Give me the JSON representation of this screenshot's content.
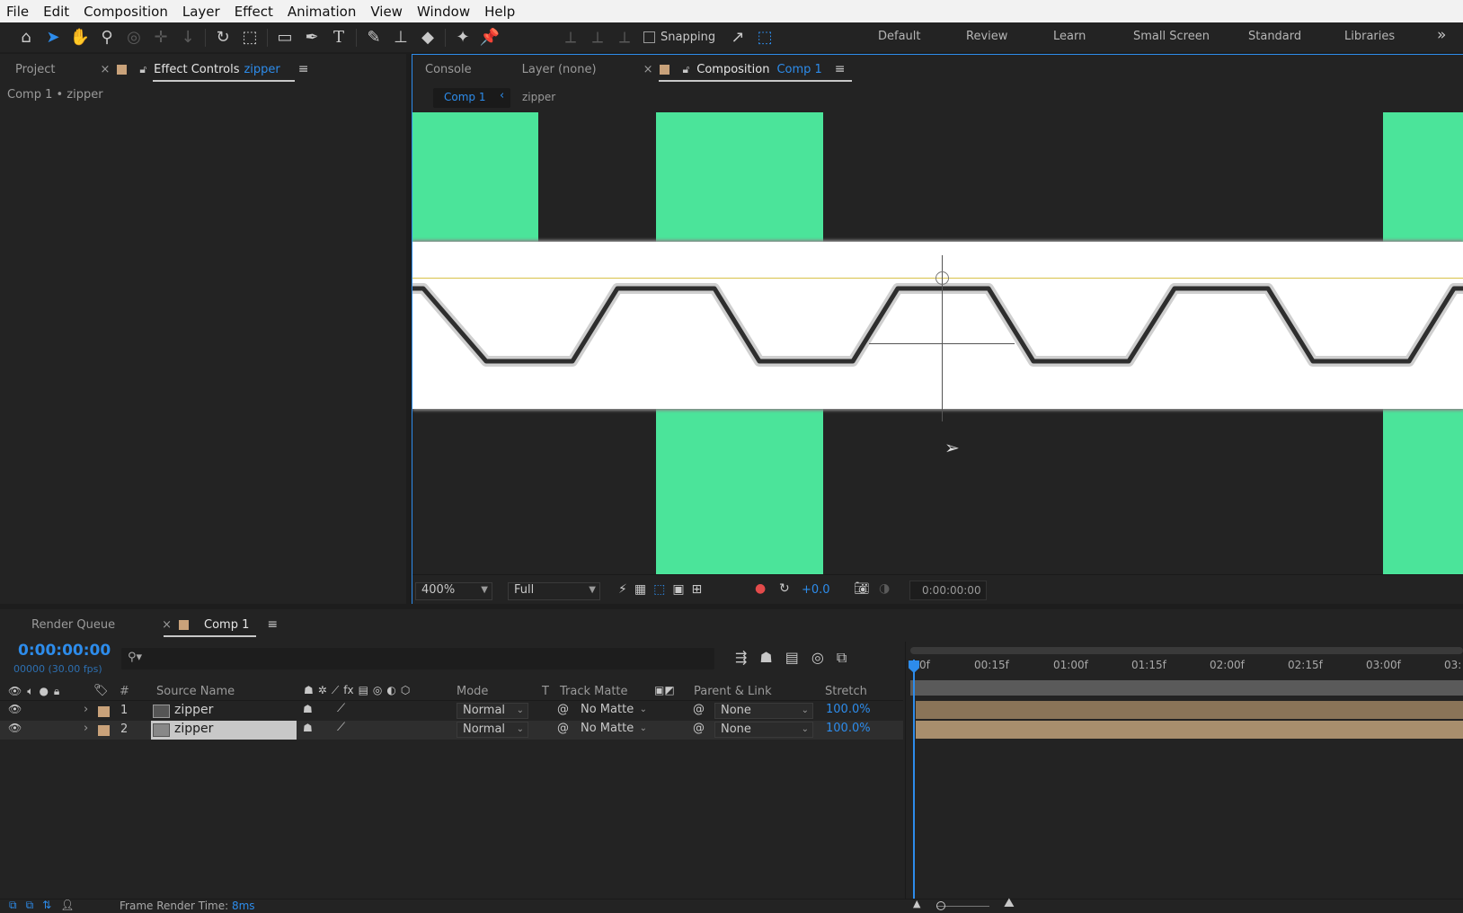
{
  "menu": [
    "File",
    "Edit",
    "Composition",
    "Layer",
    "Effect",
    "Animation",
    "View",
    "Window",
    "Help"
  ],
  "toolbar": {
    "snapping_label": "Snapping",
    "workspaces": [
      "Default",
      "Review",
      "Learn",
      "Small Screen",
      "Standard",
      "Libraries"
    ],
    "more_label": "»"
  },
  "left_panel": {
    "project_tab": "Project",
    "effect_controls_tab": "Effect Controls",
    "effect_controls_target": "zipper",
    "breadcrumb": "Comp 1 • zipper"
  },
  "comp_panel": {
    "console_tab": "Console",
    "layer_tab": "Layer (none)",
    "composition_tab": "Composition",
    "composition_target": "Comp 1",
    "nav_comp": "Comp 1",
    "nav_layer": "zipper",
    "zoom": "400%",
    "resolution": "Full",
    "exposure": "+0.0",
    "timecode": "0:00:00:00"
  },
  "timeline": {
    "render_queue_tab": "Render Queue",
    "comp_tab": "Comp 1",
    "current_time": "0:00:00:00",
    "frame_info": "00000 (30.00 fps)",
    "search_placeholder": "",
    "columns": {
      "number": "#",
      "source_name": "Source Name",
      "mode": "Mode",
      "t": "T",
      "track_matte": "Track Matte",
      "parent_link": "Parent & Link",
      "stretch": "Stretch"
    },
    "ruler": [
      "0f",
      "00:15f",
      "01:00f",
      "01:15f",
      "02:00f",
      "02:15f",
      "03:00f",
      "03:"
    ],
    "layers": [
      {
        "num": "1",
        "name": "zipper",
        "mode": "Normal",
        "matte": "No Matte",
        "parent": "None",
        "stretch": "100.0%"
      },
      {
        "num": "2",
        "name": "zipper",
        "mode": "Normal",
        "matte": "No Matte",
        "parent": "None",
        "stretch": "100.0%"
      }
    ],
    "frame_render_label": "Frame Render Time:",
    "frame_render_value": "8ms"
  },
  "colors": {
    "accent": "#2d8ceb",
    "solid_green": "#4be49a",
    "label_swatch": "#c9a27a",
    "anchor_line": "#d8c24a"
  }
}
